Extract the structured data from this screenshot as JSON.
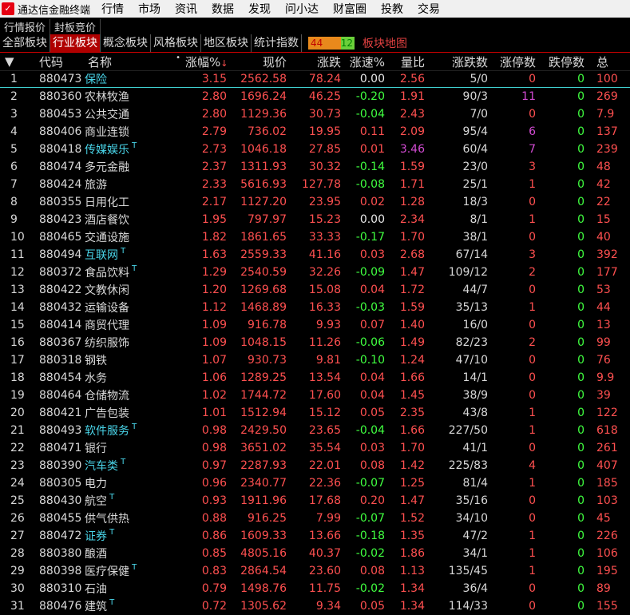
{
  "app": {
    "title": "通达信金融终端"
  },
  "menu": [
    "行情",
    "市场",
    "资讯",
    "数据",
    "发现",
    "问小达",
    "财富圈",
    "投教",
    "交易"
  ],
  "top_tabs": [
    "行情报价",
    "封板竞价"
  ],
  "sector_tabs": [
    "全部板块",
    "行业板块",
    "概念板块",
    "风格板块",
    "地区板块",
    "统计指数"
  ],
  "active_sector_tab": 1,
  "ratio": {
    "up": "44",
    "down": "12"
  },
  "map_link": "板块地图",
  "columns": {
    "idx": "",
    "code": "代码",
    "name": "名称",
    "pct": "涨幅%",
    "price": "现价",
    "chg": "涨跌",
    "speed": "涨速%",
    "vol_ratio": "量比",
    "updown": "涨跌数",
    "zt": "涨停数",
    "dt": "跌停数",
    "total": "总"
  },
  "colors": {
    "up": "#ff5050",
    "down": "#40ff40",
    "link": "#49d4e8",
    "accent": "#b00000"
  },
  "rows": [
    [
      "1",
      "880473",
      "保险",
      false,
      true,
      "3.15",
      "2562.58",
      "78.24",
      "0.00",
      "2.56",
      "5/0",
      "0",
      "0",
      "100"
    ],
    [
      "2",
      "880360",
      "农林牧渔",
      false,
      false,
      "2.80",
      "1696.24",
      "46.25",
      "-0.20",
      "1.91",
      "90/3",
      "11",
      "0",
      "269"
    ],
    [
      "3",
      "880453",
      "公共交通",
      false,
      false,
      "2.80",
      "1129.36",
      "30.73",
      "-0.04",
      "2.43",
      "7/0",
      "0",
      "0",
      "7.9"
    ],
    [
      "4",
      "880406",
      "商业连锁",
      false,
      false,
      "2.79",
      "736.02",
      "19.95",
      "0.11",
      "2.09",
      "95/4",
      "6",
      "0",
      "137"
    ],
    [
      "5",
      "880418",
      "传媒娱乐",
      true,
      true,
      "2.73",
      "1046.18",
      "27.85",
      "0.01",
      "3.46",
      "60/4",
      "7",
      "0",
      "239"
    ],
    [
      "6",
      "880474",
      "多元金融",
      false,
      false,
      "2.37",
      "1311.93",
      "30.32",
      "-0.14",
      "1.59",
      "23/0",
      "3",
      "0",
      "48"
    ],
    [
      "7",
      "880424",
      "旅游",
      false,
      false,
      "2.33",
      "5616.93",
      "127.78",
      "-0.08",
      "1.71",
      "25/1",
      "1",
      "0",
      "42"
    ],
    [
      "8",
      "880355",
      "日用化工",
      false,
      false,
      "2.17",
      "1127.20",
      "23.95",
      "0.02",
      "1.28",
      "18/3",
      "0",
      "0",
      "22"
    ],
    [
      "9",
      "880423",
      "酒店餐饮",
      false,
      false,
      "1.95",
      "797.97",
      "15.23",
      "0.00",
      "2.34",
      "8/1",
      "1",
      "0",
      "15"
    ],
    [
      "10",
      "880465",
      "交通设施",
      false,
      false,
      "1.82",
      "1861.65",
      "33.33",
      "-0.17",
      "1.70",
      "38/1",
      "0",
      "0",
      "40"
    ],
    [
      "11",
      "880494",
      "互联网",
      true,
      true,
      "1.63",
      "2559.33",
      "41.16",
      "0.03",
      "2.68",
      "67/14",
      "3",
      "0",
      "392"
    ],
    [
      "12",
      "880372",
      "食品饮料",
      true,
      false,
      "1.29",
      "2540.59",
      "32.26",
      "-0.09",
      "1.47",
      "109/12",
      "2",
      "0",
      "177"
    ],
    [
      "13",
      "880422",
      "文教休闲",
      false,
      false,
      "1.20",
      "1269.68",
      "15.08",
      "0.04",
      "1.72",
      "44/7",
      "0",
      "0",
      "53"
    ],
    [
      "14",
      "880432",
      "运输设备",
      false,
      false,
      "1.12",
      "1468.89",
      "16.33",
      "-0.03",
      "1.59",
      "35/13",
      "1",
      "0",
      "44"
    ],
    [
      "15",
      "880414",
      "商贸代理",
      false,
      false,
      "1.09",
      "916.78",
      "9.93",
      "0.07",
      "1.40",
      "16/0",
      "0",
      "0",
      "13"
    ],
    [
      "16",
      "880367",
      "纺织服饰",
      false,
      false,
      "1.09",
      "1048.15",
      "11.26",
      "-0.06",
      "1.49",
      "82/23",
      "2",
      "0",
      "99"
    ],
    [
      "17",
      "880318",
      "钢铁",
      false,
      false,
      "1.07",
      "930.73",
      "9.81",
      "-0.10",
      "1.24",
      "47/10",
      "0",
      "0",
      "76"
    ],
    [
      "18",
      "880454",
      "水务",
      false,
      false,
      "1.06",
      "1289.25",
      "13.54",
      "0.04",
      "1.66",
      "14/1",
      "0",
      "0",
      "9.9"
    ],
    [
      "19",
      "880464",
      "仓储物流",
      false,
      false,
      "1.02",
      "1744.72",
      "17.60",
      "0.04",
      "1.45",
      "38/9",
      "0",
      "0",
      "39"
    ],
    [
      "20",
      "880421",
      "广告包装",
      false,
      false,
      "1.01",
      "1512.94",
      "15.12",
      "0.05",
      "2.35",
      "43/8",
      "1",
      "0",
      "122"
    ],
    [
      "21",
      "880493",
      "软件服务",
      true,
      true,
      "0.98",
      "2429.50",
      "23.65",
      "-0.04",
      "1.66",
      "227/50",
      "1",
      "0",
      "618"
    ],
    [
      "22",
      "880471",
      "银行",
      false,
      false,
      "0.98",
      "3651.02",
      "35.54",
      "0.03",
      "1.70",
      "41/1",
      "0",
      "0",
      "261"
    ],
    [
      "23",
      "880390",
      "汽车类",
      true,
      true,
      "0.97",
      "2287.93",
      "22.01",
      "0.08",
      "1.42",
      "225/83",
      "4",
      "0",
      "407"
    ],
    [
      "24",
      "880305",
      "电力",
      false,
      false,
      "0.96",
      "2340.77",
      "22.36",
      "-0.07",
      "1.25",
      "81/4",
      "1",
      "0",
      "185"
    ],
    [
      "25",
      "880430",
      "航空",
      true,
      false,
      "0.93",
      "1911.96",
      "17.68",
      "0.20",
      "1.47",
      "35/16",
      "0",
      "0",
      "103"
    ],
    [
      "26",
      "880455",
      "供气供热",
      false,
      false,
      "0.88",
      "916.25",
      "7.99",
      "-0.07",
      "1.52",
      "34/10",
      "0",
      "0",
      "45"
    ],
    [
      "27",
      "880472",
      "证券",
      true,
      true,
      "0.86",
      "1609.33",
      "13.66",
      "-0.18",
      "1.35",
      "47/2",
      "1",
      "0",
      "226"
    ],
    [
      "28",
      "880380",
      "酿酒",
      false,
      false,
      "0.85",
      "4805.16",
      "40.37",
      "-0.02",
      "1.86",
      "34/1",
      "1",
      "0",
      "106"
    ],
    [
      "29",
      "880398",
      "医疗保健",
      true,
      false,
      "0.83",
      "2864.54",
      "23.60",
      "0.08",
      "1.13",
      "135/45",
      "1",
      "0",
      "195"
    ],
    [
      "30",
      "880310",
      "石油",
      false,
      false,
      "0.79",
      "1498.76",
      "11.75",
      "-0.02",
      "1.34",
      "36/4",
      "0",
      "0",
      "89"
    ],
    [
      "31",
      "880476",
      "建筑",
      true,
      false,
      "0.72",
      "1305.62",
      "9.34",
      "0.05",
      "1.34",
      "114/33",
      "0",
      "0",
      "155"
    ]
  ]
}
